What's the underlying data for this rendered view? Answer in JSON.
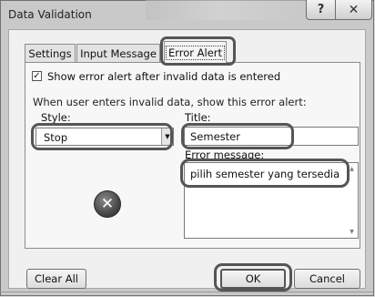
{
  "window": {
    "title": "Data Validation",
    "help": "?",
    "close": "✕"
  },
  "tabs": [
    {
      "label": "Settings",
      "active": false
    },
    {
      "label": "Input Message",
      "active": false
    },
    {
      "label": "Error Alert",
      "active": true
    }
  ],
  "error_alert": {
    "show_alert": {
      "label": "Show error alert after invalid data is entered",
      "checked": true,
      "check_glyph": "✓"
    },
    "section_label": "When user enters invalid data, show this error alert:",
    "style": {
      "label": "Style:",
      "value": "Stop",
      "arrow": "▼"
    },
    "title": {
      "label": "Title:",
      "value": "Semester"
    },
    "error_message": {
      "label": "Error message:",
      "value": "pilih semester yang tersedia",
      "scroll_up": "▲",
      "scroll_down": "▼"
    },
    "icon": {
      "name": "stop-icon",
      "glyph": "✕"
    }
  },
  "buttons": {
    "clear_all": "Clear All",
    "ok": "OK",
    "cancel": "Cancel"
  }
}
